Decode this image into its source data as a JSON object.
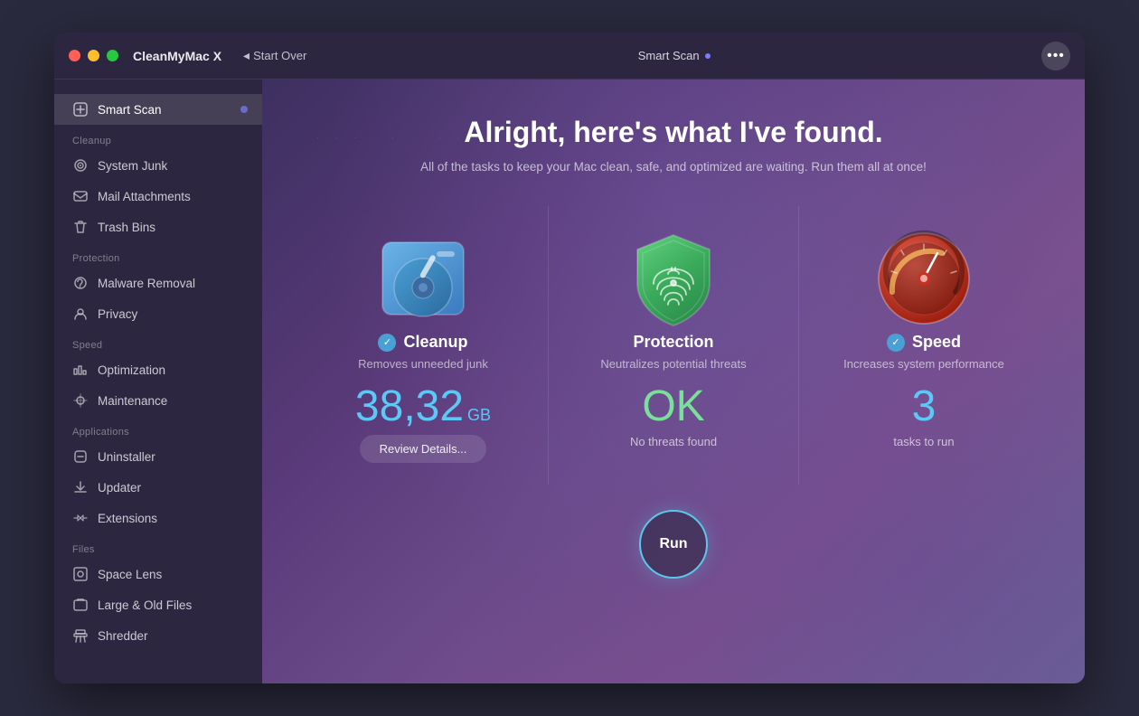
{
  "window": {
    "app_title": "CleanMyMac X",
    "back_label": "Start Over",
    "scan_label": "Smart Scan",
    "more_icon": "···"
  },
  "traffic_lights": {
    "red": "#ff5f57",
    "yellow": "#febc2e",
    "green": "#28c840"
  },
  "sidebar": {
    "active_item": "smart-scan",
    "items": [
      {
        "id": "smart-scan",
        "label": "Smart Scan",
        "section": null
      },
      {
        "id": "system-junk",
        "label": "System Junk",
        "section": "Cleanup"
      },
      {
        "id": "mail-attachments",
        "label": "Mail Attachments",
        "section": null
      },
      {
        "id": "trash-bins",
        "label": "Trash Bins",
        "section": null
      },
      {
        "id": "malware-removal",
        "label": "Malware Removal",
        "section": "Protection"
      },
      {
        "id": "privacy",
        "label": "Privacy",
        "section": null
      },
      {
        "id": "optimization",
        "label": "Optimization",
        "section": "Speed"
      },
      {
        "id": "maintenance",
        "label": "Maintenance",
        "section": null
      },
      {
        "id": "uninstaller",
        "label": "Uninstaller",
        "section": "Applications"
      },
      {
        "id": "updater",
        "label": "Updater",
        "section": null
      },
      {
        "id": "extensions",
        "label": "Extensions",
        "section": null
      },
      {
        "id": "space-lens",
        "label": "Space Lens",
        "section": "Files"
      },
      {
        "id": "large-old-files",
        "label": "Large & Old Files",
        "section": null
      },
      {
        "id": "shredder",
        "label": "Shredder",
        "section": null
      }
    ],
    "sections": {
      "cleanup": "Cleanup",
      "protection": "Protection",
      "speed": "Speed",
      "applications": "Applications",
      "files": "Files"
    }
  },
  "main": {
    "headline": "Alright, here's what I've found.",
    "subheadline": "All of the tasks to keep your Mac clean, safe, and optimized are waiting. Run them all at once!",
    "cards": [
      {
        "id": "cleanup",
        "title": "Cleanup",
        "subtitle": "Removes unneeded junk",
        "value": "38,32",
        "unit": "GB",
        "note": null,
        "has_check": true,
        "has_review": true,
        "review_label": "Review Details...",
        "value_class": "cleanup"
      },
      {
        "id": "protection",
        "title": "Protection",
        "subtitle": "Neutralizes potential threats",
        "value": "OK",
        "unit": null,
        "note": "No threats found",
        "has_check": false,
        "has_review": false,
        "review_label": null,
        "value_class": "protection"
      },
      {
        "id": "speed",
        "title": "Speed",
        "subtitle": "Increases system performance",
        "value": "3",
        "unit": null,
        "note": "tasks to run",
        "has_check": true,
        "has_review": false,
        "review_label": null,
        "value_class": "speed"
      }
    ],
    "run_button_label": "Run"
  }
}
